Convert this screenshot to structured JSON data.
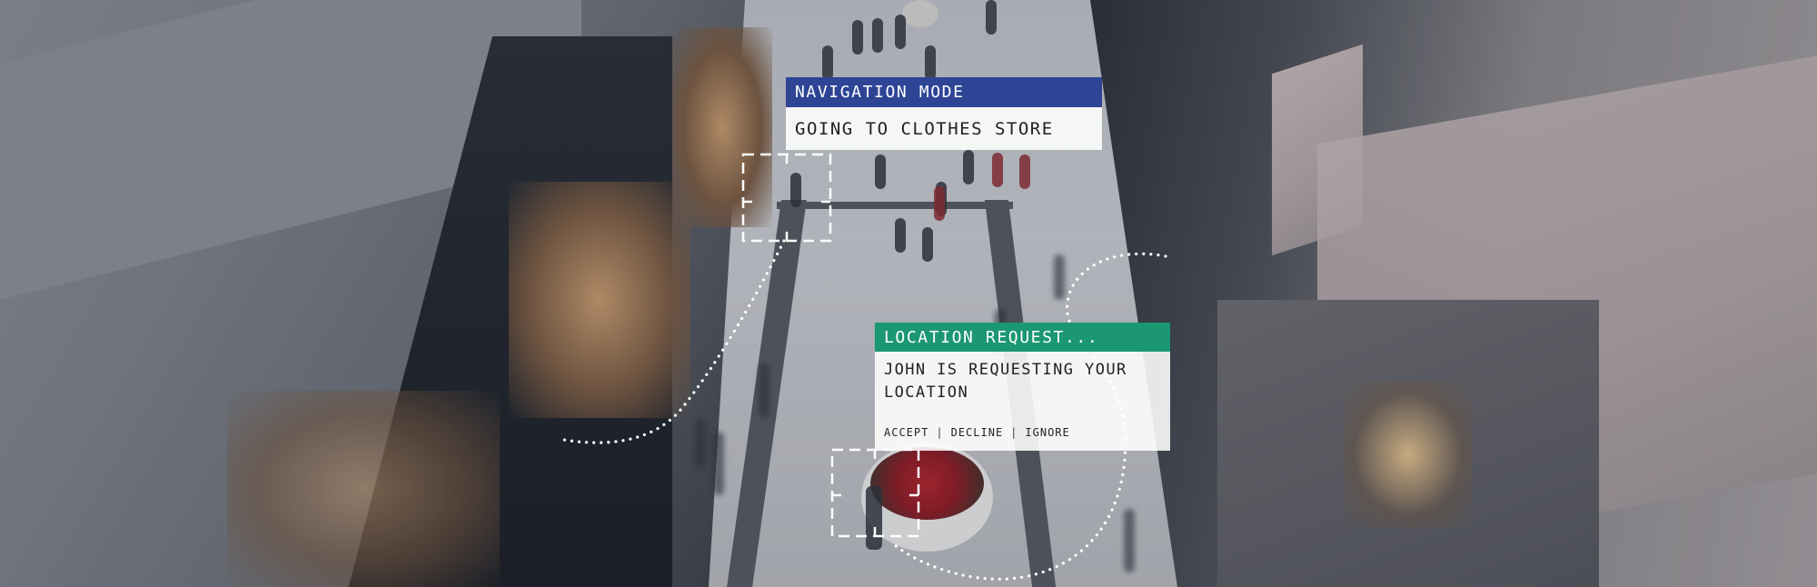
{
  "navigation": {
    "header": "NAVIGATION MODE",
    "status": "GOING TO CLOTHES STORE"
  },
  "location_request": {
    "header": "LOCATION REQUEST...",
    "message": "JOHN IS REQUESTING YOUR LOCATION",
    "actions": {
      "accept": "ACCEPT",
      "separator": "|",
      "decline": "DECLINE",
      "ignore": "IGNORE"
    }
  },
  "colors": {
    "navigation_header": "#2e4596",
    "location_header": "#1b9771",
    "card_body": "#ffffff",
    "hud_lines": "#ffffff"
  },
  "icons": {
    "target_frame_top": "target-frame-icon",
    "target_frame_bottom": "target-frame-icon",
    "route_path": "dotted-route-line"
  }
}
